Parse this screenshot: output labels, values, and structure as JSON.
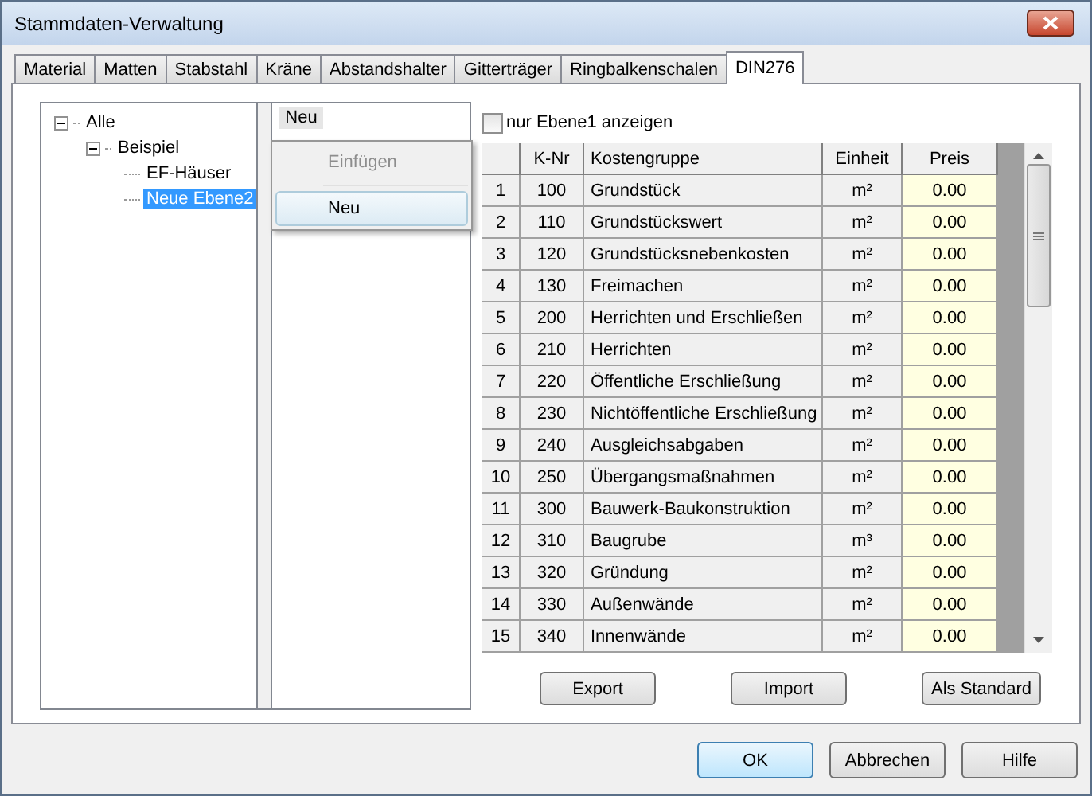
{
  "window": {
    "title": "Stammdaten-Verwaltung"
  },
  "tabs": [
    {
      "label": "Material",
      "selected": false
    },
    {
      "label": "Matten",
      "selected": false
    },
    {
      "label": "Stabstahl",
      "selected": false
    },
    {
      "label": "Kräne",
      "selected": false
    },
    {
      "label": "Abstandshalter",
      "selected": false
    },
    {
      "label": "Gitterträger",
      "selected": false
    },
    {
      "label": "Ringbalkenschalen",
      "selected": false
    },
    {
      "label": "DIN276",
      "selected": true
    }
  ],
  "tree": [
    {
      "label": "Alle",
      "expanded": true,
      "selected": false,
      "children": [
        {
          "label": "Beispiel",
          "expanded": true,
          "selected": false,
          "children": [
            {
              "label": "EF-Häuser",
              "selected": false
            },
            {
              "label": "Neue Ebene2",
              "selected": true
            }
          ]
        }
      ]
    }
  ],
  "list": {
    "items": [
      {
        "label": "Neu",
        "selected": true
      }
    ]
  },
  "context_menu": {
    "items": [
      {
        "label": "Einfügen",
        "disabled": true,
        "selected": false
      },
      {
        "label": "Neu",
        "disabled": false,
        "selected": true
      }
    ]
  },
  "filter_checkbox": {
    "label": "nur Ebene1 anzeigen",
    "checked": false
  },
  "table": {
    "columns": [
      "K-Nr",
      "Kostengruppe",
      "Einheit",
      "Preis"
    ],
    "rows": [
      {
        "index": "1",
        "k_nr": "100",
        "kostengruppe": "Grundstück",
        "einheit": "m²",
        "preis": "0.00"
      },
      {
        "index": "2",
        "k_nr": "110",
        "kostengruppe": "Grundstückswert",
        "einheit": "m²",
        "preis": "0.00"
      },
      {
        "index": "3",
        "k_nr": "120",
        "kostengruppe": "Grundstücksnebenkosten",
        "einheit": "m²",
        "preis": "0.00"
      },
      {
        "index": "4",
        "k_nr": "130",
        "kostengruppe": "Freimachen",
        "einheit": "m²",
        "preis": "0.00"
      },
      {
        "index": "5",
        "k_nr": "200",
        "kostengruppe": "Herrichten und Erschließen",
        "einheit": "m²",
        "preis": "0.00"
      },
      {
        "index": "6",
        "k_nr": "210",
        "kostengruppe": "Herrichten",
        "einheit": "m²",
        "preis": "0.00"
      },
      {
        "index": "7",
        "k_nr": "220",
        "kostengruppe": "Öffentliche Erschließung",
        "einheit": "m²",
        "preis": "0.00"
      },
      {
        "index": "8",
        "k_nr": "230",
        "kostengruppe": "Nichtöffentliche Erschließung",
        "einheit": "m²",
        "preis": "0.00"
      },
      {
        "index": "9",
        "k_nr": "240",
        "kostengruppe": "Ausgleichsabgaben",
        "einheit": "m²",
        "preis": "0.00"
      },
      {
        "index": "10",
        "k_nr": "250",
        "kostengruppe": "Übergangsmaßnahmen",
        "einheit": "m²",
        "preis": "0.00"
      },
      {
        "index": "11",
        "k_nr": "300",
        "kostengruppe": "Bauwerk-Baukonstruktion",
        "einheit": "m²",
        "preis": "0.00"
      },
      {
        "index": "12",
        "k_nr": "310",
        "kostengruppe": "Baugrube",
        "einheit": "m³",
        "preis": "0.00"
      },
      {
        "index": "13",
        "k_nr": "320",
        "kostengruppe": "Gründung",
        "einheit": "m²",
        "preis": "0.00"
      },
      {
        "index": "14",
        "k_nr": "330",
        "kostengruppe": "Außenwände",
        "einheit": "m²",
        "preis": "0.00"
      },
      {
        "index": "15",
        "k_nr": "340",
        "kostengruppe": "Innenwände",
        "einheit": "m²",
        "preis": "0.00"
      }
    ]
  },
  "panel_buttons": [
    "Export",
    "Import",
    "Als Standard"
  ],
  "dialog_buttons": [
    {
      "label": "OK",
      "default": true
    },
    {
      "label": "Abbrechen",
      "default": false
    },
    {
      "label": "Hilfe",
      "default": false
    }
  ]
}
